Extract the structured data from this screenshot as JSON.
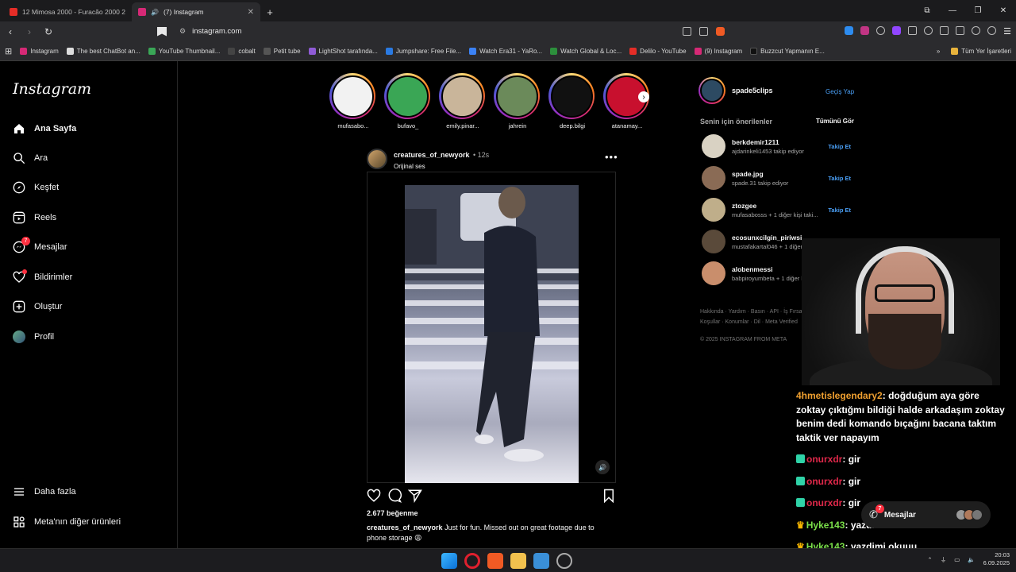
{
  "browser": {
    "tabs": [
      {
        "title": "12 Mimosa 2000 - Furacão 2000 27 a",
        "active": false,
        "favicon_color": "#e52d27"
      },
      {
        "title": "(7) Instagram",
        "active": true,
        "favicon_color": "#d62976"
      }
    ],
    "new_tab": "+",
    "url": "instagram.com",
    "bookmarks": [
      {
        "label": "Instagram",
        "color": "#d62976"
      },
      {
        "label": "The best ChatBot an...",
        "color": "#dddddd"
      },
      {
        "label": "YouTube Thumbnail...",
        "color": "#3aa757"
      },
      {
        "label": "cobalt",
        "color": "#444444"
      },
      {
        "label": "Petit tube",
        "color": "#222222"
      },
      {
        "label": "LightShot tarafında...",
        "color": "#8f5bd6"
      },
      {
        "label": "Jumpshare: Free File...",
        "color": "#2a7ae2"
      },
      {
        "label": "Watch Era31 - YaRo...",
        "color": "#3b82f6"
      },
      {
        "label": "Watch Global & Loc...",
        "color": "#2c8f3c"
      },
      {
        "label": "Delilo - YouTube",
        "color": "#e52d27"
      },
      {
        "label": "(9) Instagram",
        "color": "#d62976"
      },
      {
        "label": "Buzzcut Yapmanın E...",
        "color": "#111111"
      }
    ],
    "all_bookmarks": "Tüm Yer İşaretleri"
  },
  "sidebar": {
    "logo": "Instagram",
    "items": [
      {
        "label": "Ana Sayfa",
        "icon": "home-icon",
        "bold": true
      },
      {
        "label": "Ara",
        "icon": "search-icon"
      },
      {
        "label": "Keşfet",
        "icon": "compass-icon"
      },
      {
        "label": "Reels",
        "icon": "reels-icon"
      },
      {
        "label": "Mesajlar",
        "icon": "messenger-icon",
        "badge": "7"
      },
      {
        "label": "Bildirimler",
        "icon": "heart-icon",
        "dot": true
      },
      {
        "label": "Oluştur",
        "icon": "plus-square-icon"
      },
      {
        "label": "Profil",
        "icon": "avatar"
      }
    ],
    "more": "Daha fazla",
    "meta": "Meta'nın diğer ürünleri"
  },
  "stories": [
    {
      "name": "mufasabo...",
      "color": "#f2f2f2"
    },
    {
      "name": "bufavo_",
      "color": "#3aa655"
    },
    {
      "name": "emily.pinar...",
      "color": "#c9b59a"
    },
    {
      "name": "jahrein",
      "color": "#6b8a5a"
    },
    {
      "name": "deep.bilgi",
      "color": "#111111"
    },
    {
      "name": "atanamay...",
      "color": "#c8102e"
    }
  ],
  "post": {
    "username": "creatures_of_newyork",
    "time": "12s",
    "audio": "Orijinal ses",
    "likes": "2.677 beğenme",
    "caption_user": "creatures_of_newyork",
    "caption_text": "Just for fun. Missed out on great footage due to phone storage 😩"
  },
  "right": {
    "me": "spade5clips",
    "switch": "Geçiş Yap",
    "suggestions_title": "Senin için önerilenler",
    "see_all": "Tümünü Gör",
    "follow": "Takip Et",
    "suggestions": [
      {
        "name": "berkdemir1211",
        "sub": "ajdarinkeli1453 takip ediyor",
        "color": "#d9d2c3"
      },
      {
        "name": "spade.jpg",
        "sub": "spade.31 takip ediyor",
        "color": "#8a6b55"
      },
      {
        "name": "ztozgee",
        "sub": "mufasabosss + 1 diğer kişi taki...",
        "color": "#bfae8a"
      },
      {
        "name": "ecosunxcilgin_piriwsi",
        "sub": "mustafakartal046 + 1 diğer kişi...",
        "color": "#5a4a3a"
      },
      {
        "name": "alobenmessi",
        "sub": "babpiroyumbeta + 1 diğer kişi ...",
        "color": "#c98e6c"
      }
    ],
    "footer": "Hakkında · Yardım · Basın · API · İş Fırsatları · Gizlilik · Koşullar · Konumlar · Dil · Meta Verified",
    "copyright": "© 2025 INSTAGRAM FROM META"
  },
  "chat": [
    {
      "user": "4hmetislegendary2",
      "color": "#f0a030",
      "text": "doğduğum aya göre zoktay çıktığmı bildiği halde arkadaşım zoktay benim dedi komando bıçağını bacana taktım taktik ver napayım",
      "badge": ""
    },
    {
      "user": "onurxdr",
      "color": "#e0284a",
      "text": "gir",
      "badge": "#2fd3a8"
    },
    {
      "user": "onurxdr",
      "color": "#e0284a",
      "text": "gir",
      "badge": "#2fd3a8"
    },
    {
      "user": "onurxdr",
      "color": "#e0284a",
      "text": "gir",
      "badge": "#2fd3a8"
    },
    {
      "user": "Hyke143",
      "color": "#7be04a",
      "text": "yazdimi okusana abi",
      "badge": "crown"
    },
    {
      "user": "Hyke143",
      "color": "#7be04a",
      "text": "yazdimi okuuu",
      "badge": "crown"
    }
  ],
  "dm_pill": {
    "label": "Mesajlar",
    "badge": "7"
  },
  "taskbar": {
    "time": "20:03",
    "date": "6.09.2025"
  }
}
